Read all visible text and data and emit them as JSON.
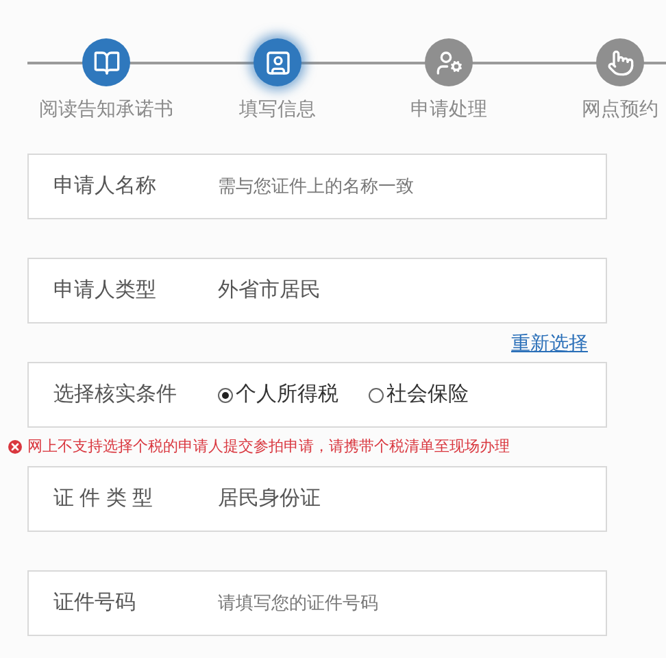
{
  "steps": [
    {
      "label": "阅读告知承诺书",
      "completed": true,
      "selected": false
    },
    {
      "label": "填写信息",
      "completed": true,
      "selected": true
    },
    {
      "label": "申请处理",
      "completed": false,
      "selected": false
    },
    {
      "label": "网点预约",
      "completed": false,
      "selected": false
    }
  ],
  "fields": [
    {
      "kind": "input",
      "label": "申请人名称",
      "placeholder": "需与您证件上的名称一致"
    },
    {
      "kind": "value",
      "label": "申请人类型",
      "value": "外省市居民",
      "link": "重新选择"
    },
    {
      "kind": "radio",
      "label": "选择核实条件",
      "options": [
        {
          "label": "个人所得税",
          "selected": true
        },
        {
          "label": "社会保险",
          "selected": false
        }
      ],
      "error": "网上不支持选择个税的申请人提交参拍申请，请携带个税清单至现场办理"
    },
    {
      "kind": "value",
      "label": "证 件 类 型",
      "value": "居民身份证"
    },
    {
      "kind": "input",
      "label": "证件号码",
      "placeholder": "请填写您的证件号码"
    }
  ]
}
